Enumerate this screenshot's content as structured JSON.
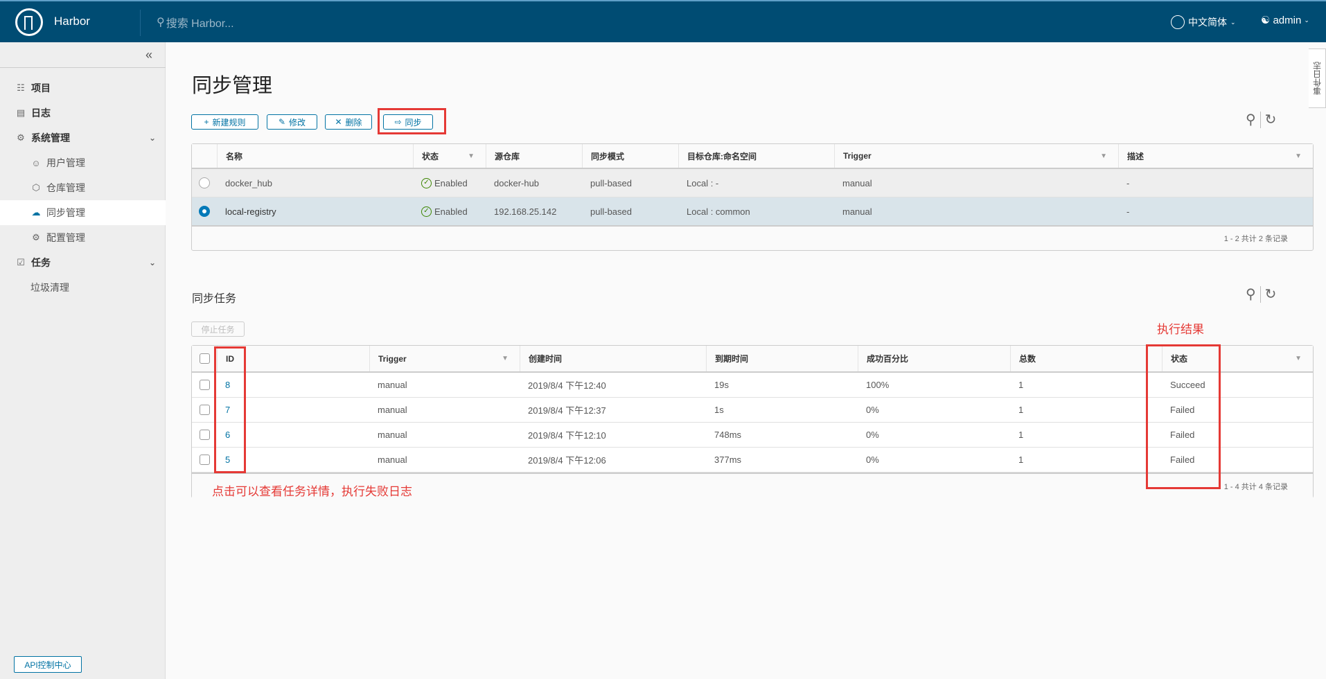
{
  "header": {
    "brand": "Harbor",
    "search_placeholder": "搜索 Harbor...",
    "language": "中文简体",
    "user": "admin"
  },
  "sidebar": {
    "items": [
      {
        "label": "项目",
        "icon": "projects-icon"
      },
      {
        "label": "日志",
        "icon": "log-icon"
      },
      {
        "label": "系统管理",
        "icon": "admin-icon"
      },
      {
        "label": "用户管理",
        "icon": "users-icon"
      },
      {
        "label": "仓库管理",
        "icon": "registry-icon"
      },
      {
        "label": "同步管理",
        "icon": "replication-icon",
        "active": true
      },
      {
        "label": "配置管理",
        "icon": "gear-icon"
      },
      {
        "label": "任务",
        "icon": "tasks-icon"
      },
      {
        "label": "垃圾清理"
      }
    ],
    "api_button": "API控制中心"
  },
  "event_log_tab": "事件日志",
  "page": {
    "title": "同步管理",
    "toolbar": {
      "new_rule": "新建规则",
      "edit": "修改",
      "delete": "删除",
      "replicate": "同步"
    },
    "rules": {
      "columns": [
        "名称",
        "状态",
        "源仓库",
        "同步模式",
        "目标仓库:命名空间",
        "Trigger",
        "描述"
      ],
      "rows": [
        {
          "name": "docker_hub",
          "status": "Enabled",
          "source": "docker-hub",
          "mode": "pull-based",
          "dest": "Local : -",
          "trigger": "manual",
          "desc": "-",
          "selected": false
        },
        {
          "name": "local-registry",
          "status": "Enabled",
          "source": "192.168.25.142",
          "mode": "pull-based",
          "dest": "Local : common",
          "trigger": "manual",
          "desc": "-",
          "selected": true
        }
      ],
      "footer": "1 - 2 共计 2 条记录"
    },
    "jobs": {
      "title": "同步任务",
      "stop_button": "停止任务",
      "columns": [
        "ID",
        "Trigger",
        "创建时间",
        "到期时间",
        "成功百分比",
        "总数",
        "状态"
      ],
      "rows": [
        {
          "id": "8",
          "trigger": "manual",
          "created": "2019/8/4 下午12:40",
          "duration": "19s",
          "success": "100%",
          "total": "1",
          "status": "Succeed"
        },
        {
          "id": "7",
          "trigger": "manual",
          "created": "2019/8/4 下午12:37",
          "duration": "1s",
          "success": "0%",
          "total": "1",
          "status": "Failed"
        },
        {
          "id": "6",
          "trigger": "manual",
          "created": "2019/8/4 下午12:10",
          "duration": "748ms",
          "success": "0%",
          "total": "1",
          "status": "Failed"
        },
        {
          "id": "5",
          "trigger": "manual",
          "created": "2019/8/4 下午12:06",
          "duration": "377ms",
          "success": "0%",
          "total": "1",
          "status": "Failed"
        }
      ],
      "footer": "1 - 4 共计 4 条记录"
    }
  },
  "annotations": {
    "result_label": "执行结果",
    "id_hint": "点击可以查看任务详情，执行失败日志",
    "color": "#e53935"
  }
}
